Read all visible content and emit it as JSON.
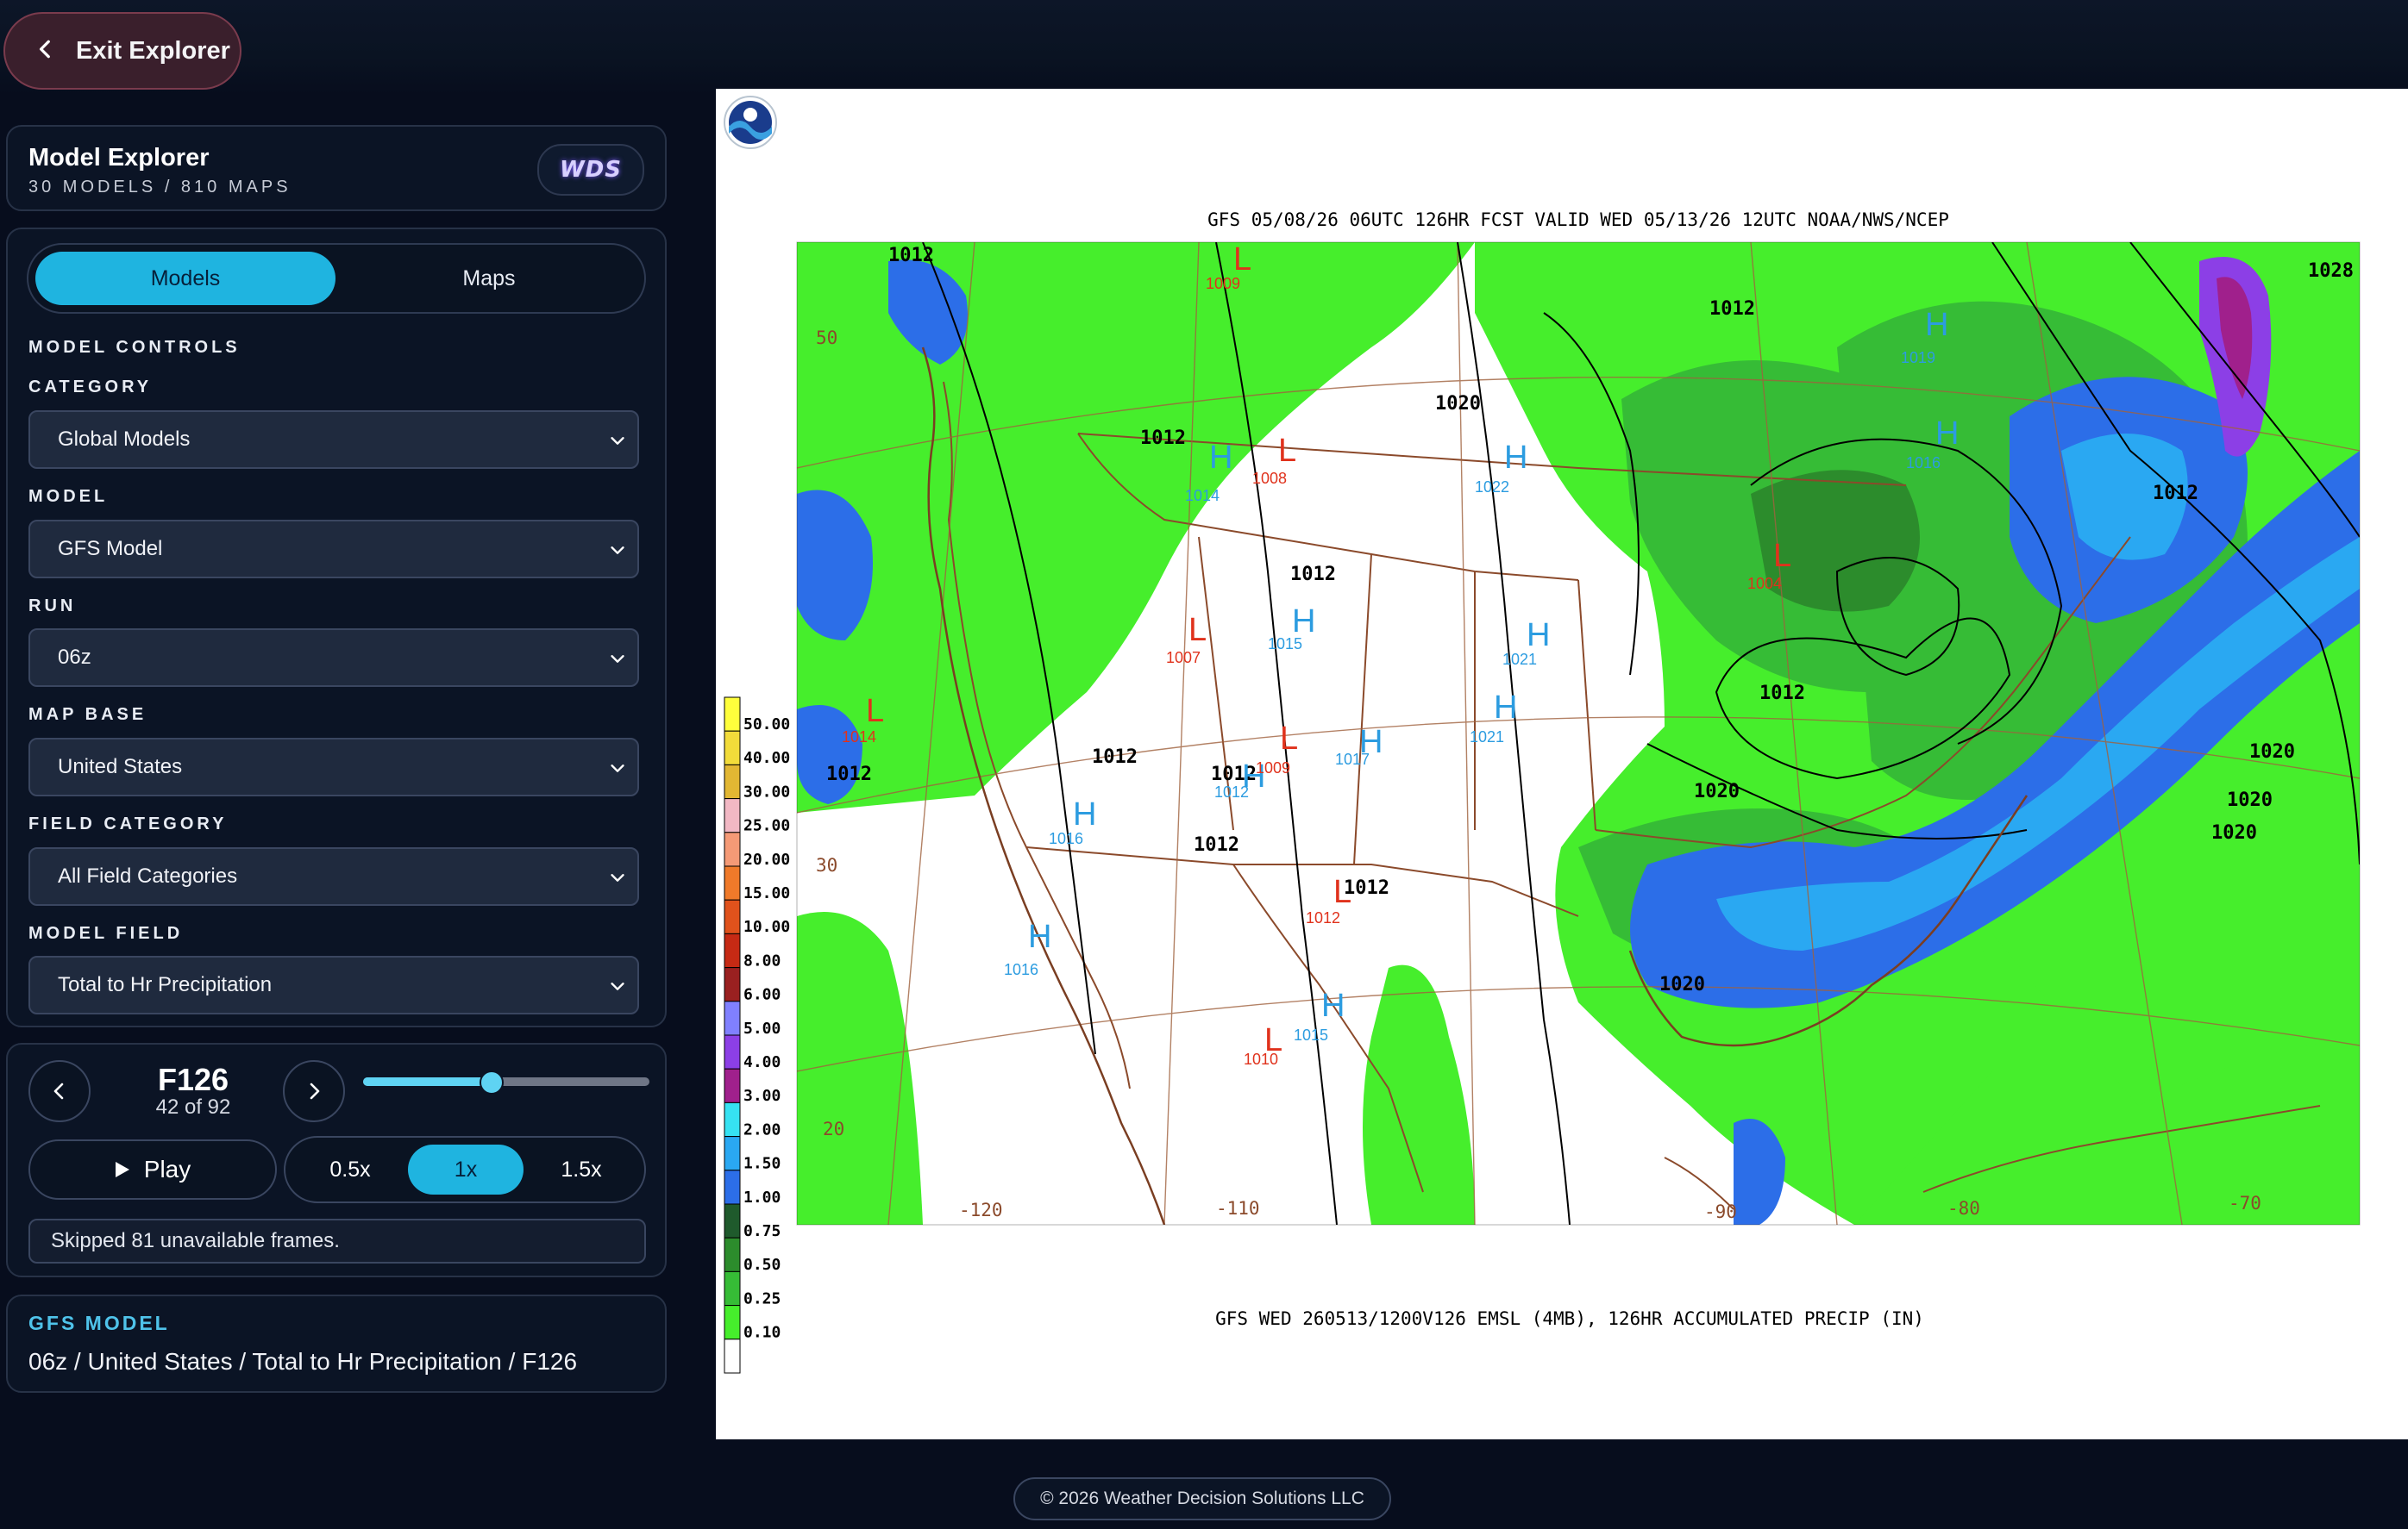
{
  "nav": {
    "exit_label": "Exit Explorer"
  },
  "header": {
    "title": "Model Explorer",
    "subtitle": "30 MODELS / 810 MAPS",
    "logo_text": "WDS"
  },
  "tabs": {
    "models": "Models",
    "maps": "Maps"
  },
  "controls": {
    "section_title": "MODEL CONTROLS",
    "category_label": "CATEGORY",
    "category_value": "Global Models",
    "model_label": "MODEL",
    "model_value": "GFS Model",
    "run_label": "RUN",
    "run_value": "06z",
    "map_base_label": "MAP BASE",
    "map_base_value": "United States",
    "field_category_label": "FIELD CATEGORY",
    "field_category_value": "All Field Categories",
    "model_field_label": "MODEL FIELD",
    "model_field_value": "Total to Hr Precipitation"
  },
  "player": {
    "frame": "F126",
    "position": "42 of 92",
    "progress": 0.45,
    "play_label": "Play",
    "speeds": [
      "0.5x",
      "1x",
      "1.5x"
    ],
    "active_speed": "1x",
    "note": "Skipped 81 unavailable frames."
  },
  "status": {
    "title": "GFS MODEL",
    "summary": "06z / United States / Total to Hr Precipitation / F126"
  },
  "map": {
    "header_text": "GFS 05/08/26 06UTC 126HR FCST VALID WED 05/13/26 12UTC NOAA/NWS/NCEP",
    "footer_text": "GFS WED 260513/1200V126 EMSL (4MB), 126HR ACCUMULATED PRECIP (IN)",
    "legend": [
      {
        "label": "50.00",
        "color": "#ffff3c"
      },
      {
        "label": "40.00",
        "color": "#f2dc3a"
      },
      {
        "label": "30.00",
        "color": "#e2b733"
      },
      {
        "label": "25.00",
        "color": "#f2b8c4"
      },
      {
        "label": "20.00",
        "color": "#f59a76"
      },
      {
        "label": "15.00",
        "color": "#f07a2a"
      },
      {
        "label": "10.00",
        "color": "#e0521c"
      },
      {
        "label": "8.00",
        "color": "#c62a14"
      },
      {
        "label": "6.00",
        "color": "#9a2020"
      },
      {
        "label": "5.00",
        "color": "#8080ff"
      },
      {
        "label": "4.00",
        "color": "#8c3fe6"
      },
      {
        "label": "3.00",
        "color": "#a0208c"
      },
      {
        "label": "2.00",
        "color": "#36e2f2"
      },
      {
        "label": "1.50",
        "color": "#2aa8f2"
      },
      {
        "label": "1.00",
        "color": "#2c6ee8"
      },
      {
        "label": "0.75",
        "color": "#1f5a2c"
      },
      {
        "label": "0.50",
        "color": "#2c8c2c"
      },
      {
        "label": "0.25",
        "color": "#36bc36"
      },
      {
        "label": "0.10",
        "color": "#46ee2c"
      },
      {
        "label": "",
        "color": "#ffffff"
      }
    ],
    "lat_labels": [
      "50",
      "30",
      "20"
    ],
    "lon_labels": [
      "-120",
      "-110",
      "-90",
      "-80",
      "-70"
    ],
    "isobars": [
      "1012",
      "1012",
      "1020",
      "1012",
      "1012",
      "1012",
      "1012",
      "1012",
      "1012",
      "1012",
      "1012",
      "1020",
      "1020",
      "1020",
      "1020",
      "1020",
      "1012",
      "1028"
    ],
    "highs": [
      {
        "mark": "H",
        "value": "1014"
      },
      {
        "mark": "H",
        "value": "1015"
      },
      {
        "mark": "H",
        "value": "1022"
      },
      {
        "mark": "H",
        "value": "1021"
      },
      {
        "mark": "H",
        "value": "1021"
      },
      {
        "mark": "H",
        "value": "1017"
      },
      {
        "mark": "H",
        "value": "1016"
      },
      {
        "mark": "H",
        "value": "1016"
      },
      {
        "mark": "H",
        "value": "1015"
      },
      {
        "mark": "H",
        "value": "1019"
      },
      {
        "mark": "H",
        "value": "1016"
      },
      {
        "mark": "H",
        "value": "1012"
      }
    ],
    "lows": [
      {
        "mark": "L",
        "value": "1009"
      },
      {
        "mark": "L",
        "value": "1008"
      },
      {
        "mark": "L",
        "value": "1007"
      },
      {
        "mark": "L",
        "value": "1009"
      },
      {
        "mark": "L",
        "value": "1014"
      },
      {
        "mark": "L",
        "value": "1012"
      },
      {
        "mark": "L",
        "value": "1010"
      },
      {
        "mark": "L",
        "value": "1004"
      }
    ]
  },
  "footer": {
    "copyright": "© 2026 Weather Decision Solutions LLC"
  }
}
